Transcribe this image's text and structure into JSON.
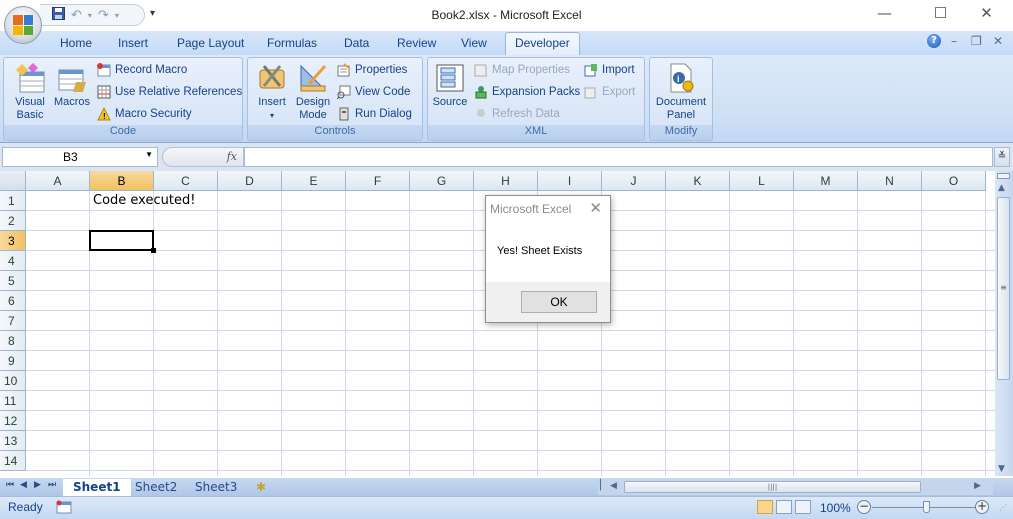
{
  "window": {
    "title": "Book2.xlsx  -  Microsoft Excel",
    "controls": {
      "minimize": "—",
      "maximize": "☐",
      "close": "✕"
    }
  },
  "quick_access": {
    "save_icon": "save-icon",
    "undo_icon": "undo-icon",
    "redo_icon": "redo-icon",
    "customize_label": "▾"
  },
  "ribbon_tabs": [
    {
      "label": "Home"
    },
    {
      "label": "Insert"
    },
    {
      "label": "Page Layout"
    },
    {
      "label": "Formulas"
    },
    {
      "label": "Data"
    },
    {
      "label": "Review"
    },
    {
      "label": "View"
    },
    {
      "label": "Developer",
      "active": true
    }
  ],
  "ribbon_controls": {
    "help": "?",
    "minimize": "–",
    "restore": "❐",
    "close": "✕"
  },
  "ribbon": {
    "code": {
      "label": "Code",
      "visual_basic": "Visual Basic",
      "visual_basic_l1": "Visual",
      "visual_basic_l2": "Basic",
      "macros": "Macros",
      "record_macro": "Record Macro",
      "use_relative": "Use Relative References",
      "macro_security": "Macro Security"
    },
    "controls": {
      "label": "Controls",
      "insert": "Insert",
      "insert_dd": "▾",
      "design_l1": "Design",
      "design_l2": "Mode",
      "properties": "Properties",
      "view_code": "View Code",
      "run_dialog": "Run Dialog"
    },
    "xml": {
      "label": "XML",
      "source": "Source",
      "map_properties": "Map Properties",
      "expansion_packs": "Expansion Packs",
      "refresh_data": "Refresh Data",
      "import": "Import",
      "export": "Export"
    },
    "modify": {
      "label": "Modify",
      "doc_l1": "Document",
      "doc_l2": "Panel"
    }
  },
  "formula_bar": {
    "name_box": "B3",
    "fx_label": "fx",
    "formula": "",
    "expand": "≚"
  },
  "grid": {
    "columns": [
      "A",
      "B",
      "C",
      "D",
      "E",
      "F",
      "G",
      "H",
      "I",
      "J",
      "K",
      "L",
      "M",
      "N",
      "O"
    ],
    "rows": [
      "1",
      "2",
      "3",
      "4",
      "5",
      "6",
      "7",
      "8",
      "9",
      "10",
      "11",
      "12",
      "13",
      "14"
    ],
    "selected_column": "B",
    "selected_row": "3",
    "cells": {
      "B1": "Code executed!"
    }
  },
  "sheet_tabs": [
    {
      "label": "Sheet1",
      "active": true
    },
    {
      "label": "Sheet2"
    },
    {
      "label": "Sheet3"
    }
  ],
  "sheet_nav": [
    "⏮",
    "◀",
    "▶",
    "⏭"
  ],
  "status_bar": {
    "ready": "Ready",
    "zoom": "100%",
    "zoom_out": "−",
    "zoom_in": "+",
    "zoom_level_percent": 100
  },
  "dialog": {
    "title": "Microsoft Excel",
    "message": "Yes! Sheet Exists",
    "ok_label": "OK",
    "close": "✕"
  }
}
